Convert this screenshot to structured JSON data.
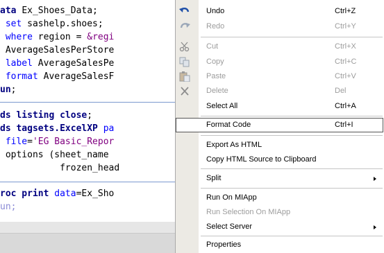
{
  "code": {
    "block1": [
      [
        {
          "c": "kw-navy",
          "t": "ata "
        },
        {
          "c": "txt",
          "t": "Ex_Shoes_Data;"
        }
      ],
      [
        {
          "c": "txt",
          "t": " "
        },
        {
          "c": "kw-blue",
          "t": "set "
        },
        {
          "c": "txt",
          "t": "sashelp.shoes;"
        }
      ],
      [
        {
          "c": "txt",
          "t": " "
        },
        {
          "c": "kw-blue",
          "t": "where "
        },
        {
          "c": "txt",
          "t": "region = "
        },
        {
          "c": "str",
          "t": "&regi"
        }
      ],
      [
        {
          "c": "txt",
          "t": " AverageSalesPerStore"
        }
      ],
      [
        {
          "c": "txt",
          "t": " "
        },
        {
          "c": "kw-blue",
          "t": "label "
        },
        {
          "c": "txt",
          "t": "AverageSalesPe"
        }
      ],
      [
        {
          "c": "txt",
          "t": " "
        },
        {
          "c": "kw-blue",
          "t": "format "
        },
        {
          "c": "txt",
          "t": "AverageSalesF"
        }
      ],
      [
        {
          "c": "kw-navy",
          "t": "un"
        },
        {
          "c": "txt",
          "t": ";"
        }
      ]
    ],
    "block2": [
      [
        {
          "c": "kw-navy",
          "t": "ds listing close"
        },
        {
          "c": "txt",
          "t": ";"
        }
      ],
      [
        {
          "c": "kw-navy",
          "t": "ds tagsets.ExcelXP "
        },
        {
          "c": "kw-blue",
          "t": "pa"
        }
      ],
      [
        {
          "c": "txt",
          "t": " "
        },
        {
          "c": "kw-blue",
          "t": "file"
        },
        {
          "c": "txt",
          "t": "="
        },
        {
          "c": "str",
          "t": "'EG Basic_Repor"
        }
      ],
      [
        {
          "c": "txt",
          "t": " options (sheet_name"
        }
      ],
      [
        {
          "c": "txt",
          "t": "           frozen_head"
        }
      ]
    ],
    "block3": [
      [
        {
          "c": "kw-navy",
          "t": "roc print "
        },
        {
          "c": "kw-blue",
          "t": "data"
        },
        {
          "c": "txt",
          "t": "=Ex_Sho"
        }
      ],
      [
        {
          "c": "faded",
          "t": "un;"
        }
      ]
    ]
  },
  "menu": {
    "items": [
      {
        "id": "undo",
        "label": "Undo",
        "shortcut": "Ctrl+Z",
        "disabled": false,
        "icon": "undo-icon"
      },
      {
        "id": "redo",
        "label": "Redo",
        "shortcut": "Ctrl+Y",
        "disabled": true,
        "icon": "redo-icon"
      },
      {
        "id": "cut",
        "label": "Cut",
        "shortcut": "Ctrl+X",
        "disabled": true,
        "icon": "scissors-icon"
      },
      {
        "id": "copy",
        "label": "Copy",
        "shortcut": "Ctrl+C",
        "disabled": true,
        "icon": "copy-icon"
      },
      {
        "id": "paste",
        "label": "Paste",
        "shortcut": "Ctrl+V",
        "disabled": true,
        "icon": "paste-icon"
      },
      {
        "id": "delete",
        "label": "Delete",
        "shortcut": "Del",
        "disabled": true,
        "icon": "delete-x-icon"
      },
      {
        "id": "select-all",
        "label": "Select All",
        "shortcut": "Ctrl+A",
        "disabled": false
      },
      {
        "id": "format-code",
        "label": "Format Code",
        "shortcut": "Ctrl+I",
        "disabled": false,
        "highlighted": true
      },
      {
        "id": "export-html",
        "label": "Export As HTML",
        "shortcut": "",
        "disabled": false
      },
      {
        "id": "copy-html",
        "label": "Copy HTML Source to Clipboard",
        "shortcut": "",
        "disabled": false
      },
      {
        "id": "split",
        "label": "Split",
        "shortcut": "",
        "disabled": false,
        "submenu": true
      },
      {
        "id": "run-miapp",
        "label": "Run On MIApp",
        "shortcut": "",
        "disabled": false
      },
      {
        "id": "run-selection-miapp",
        "label": "Run Selection On MIApp",
        "shortcut": "",
        "disabled": true
      },
      {
        "id": "select-server",
        "label": "Select Server",
        "shortcut": "",
        "disabled": false,
        "submenu": true
      },
      {
        "id": "properties",
        "label": "Properties",
        "shortcut": "",
        "disabled": false
      }
    ]
  },
  "colors": {
    "keyword_navy": "#000080",
    "keyword_blue": "#0000ff",
    "string": "#800080",
    "separator": "#7b98cf",
    "menu_gutter": "#eceae4",
    "disabled_text": "#9c9c9c"
  }
}
